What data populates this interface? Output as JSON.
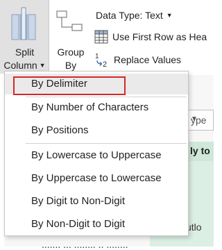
{
  "ribbon": {
    "split_column": {
      "line1": "Split",
      "line2": "Column",
      "icon": "split-column-icon"
    },
    "group_by": {
      "line1": "Group",
      "line2": "By",
      "icon": "group-by-icon"
    },
    "data_type_label": "Data Type: Text",
    "first_row_label": "Use First Row as Hea",
    "replace_values_label": "Replace Values",
    "replace_icon_text": "1→2"
  },
  "background": {
    "column_header_text": "ype",
    "green_header_text": "ly to",
    "text_fragment_1": "utlo",
    "text_fragment_2": "....... ... ........ .. ........"
  },
  "menu": {
    "items": [
      {
        "label": "By Delimiter"
      },
      {
        "label": "By Number of Characters"
      },
      {
        "label": "By Positions"
      },
      {
        "label": "By Lowercase to Uppercase"
      },
      {
        "label": "By Uppercase to Lowercase"
      },
      {
        "label": "By Digit to Non-Digit"
      },
      {
        "label": "By Non-Digit to Digit"
      }
    ]
  },
  "colors": {
    "ribbon_active": "#e1e1e1",
    "highlight_border": "#d4272b",
    "hover_bg": "#eaeaea",
    "green_panel": "#dbefe4"
  }
}
